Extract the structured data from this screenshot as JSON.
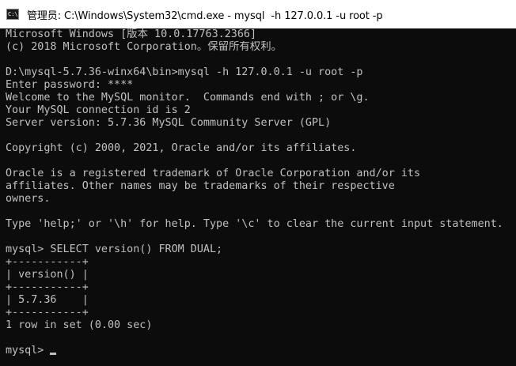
{
  "window": {
    "title": "管理员: C:\\Windows\\System32\\cmd.exe - mysql  -h 127.0.0.1 -u root -p"
  },
  "console": {
    "lines": [
      "Microsoft Windows [版本 10.0.17763.2366]",
      "(c) 2018 Microsoft Corporation。保留所有权利。",
      "",
      "D:\\mysql-5.7.36-winx64\\bin>mysql -h 127.0.0.1 -u root -p",
      "Enter password: ****",
      "Welcome to the MySQL monitor.  Commands end with ; or \\g.",
      "Your MySQL connection id is 2",
      "Server version: 5.7.36 MySQL Community Server (GPL)",
      "",
      "Copyright (c) 2000, 2021, Oracle and/or its affiliates.",
      "",
      "Oracle is a registered trademark of Oracle Corporation and/or its",
      "affiliates. Other names may be trademarks of their respective",
      "owners.",
      "",
      "Type 'help;' or '\\h' for help. Type '\\c' to clear the current input statement.",
      "",
      "mysql> SELECT version() FROM DUAL;",
      "+-----------+",
      "| version() |",
      "+-----------+",
      "| 5.7.36    |",
      "+-----------+",
      "1 row in set (0.00 sec)",
      ""
    ],
    "prompt": "mysql> "
  },
  "colors": {
    "background": "#0c0c0c",
    "foreground": "#c0c0c0",
    "titlebar": "#ffffff"
  }
}
